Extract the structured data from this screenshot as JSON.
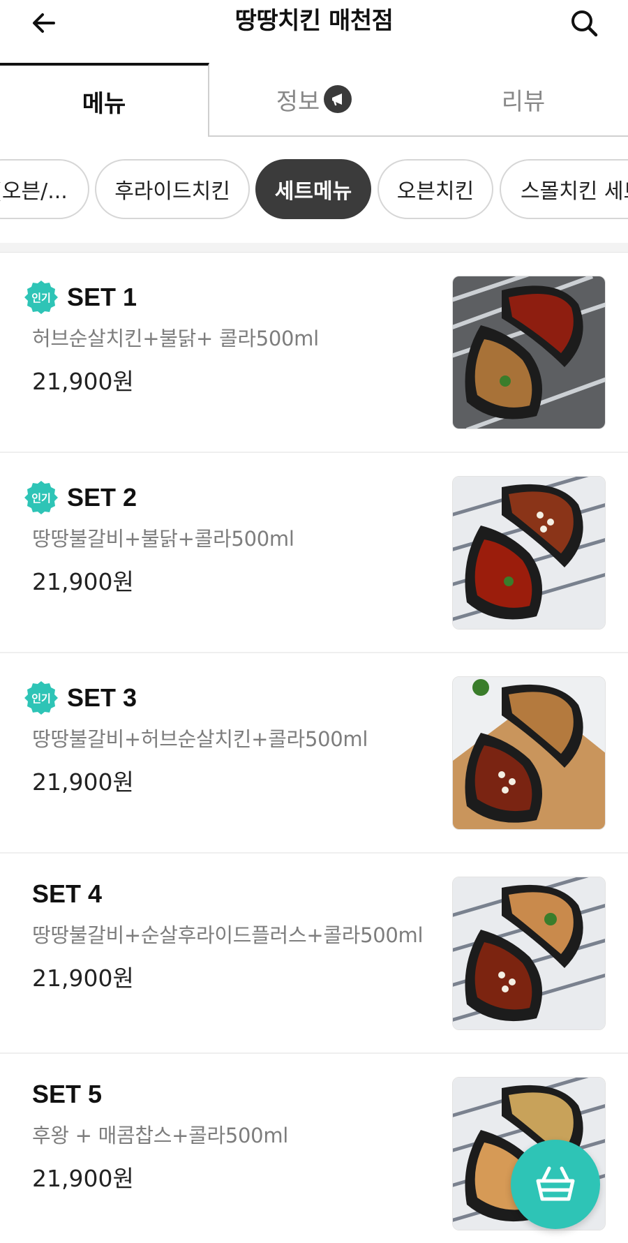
{
  "header": {
    "title": "땅땅치킨 매천점",
    "back_icon": "arrow-left-icon",
    "search_icon": "search-icon"
  },
  "tabs": [
    {
      "label": "메뉴",
      "active": true
    },
    {
      "label": "정보",
      "active": false,
      "icon": "megaphone-icon"
    },
    {
      "label": "리뷰",
      "active": false
    }
  ],
  "categories": [
    {
      "label": "(오븐/...",
      "active": false
    },
    {
      "label": "후라이드치킨",
      "active": false
    },
    {
      "label": "세트메뉴",
      "active": true
    },
    {
      "label": "오븐치킨",
      "active": false
    },
    {
      "label": "스몰치킨 세트",
      "active": false
    }
  ],
  "popular_badge_label": "인기",
  "menu_items": [
    {
      "name": "SET 1",
      "popular": true,
      "description": "허브순살치킨+불닭+ 콜라500ml",
      "price": "21,900원"
    },
    {
      "name": "SET 2",
      "popular": true,
      "description": "땅땅불갈비+불닭+콜라500ml",
      "price": "21,900원"
    },
    {
      "name": "SET 3",
      "popular": true,
      "description": "땅땅불갈비+허브순살치킨+콜라500ml",
      "price": "21,900원"
    },
    {
      "name": "SET 4",
      "popular": false,
      "description": "땅땅불갈비+순살후라이드플러스+콜라500ml",
      "price": "21,900원"
    },
    {
      "name": "SET 5",
      "popular": false,
      "description": "후왕 + 매콤찹스+콜라500ml",
      "price": "21,900원"
    }
  ],
  "cart": {
    "icon": "basket-icon"
  },
  "colors": {
    "accent": "#2ec4b6",
    "chip_active": "#3b3b3b",
    "text_muted": "#7d7d7d"
  }
}
